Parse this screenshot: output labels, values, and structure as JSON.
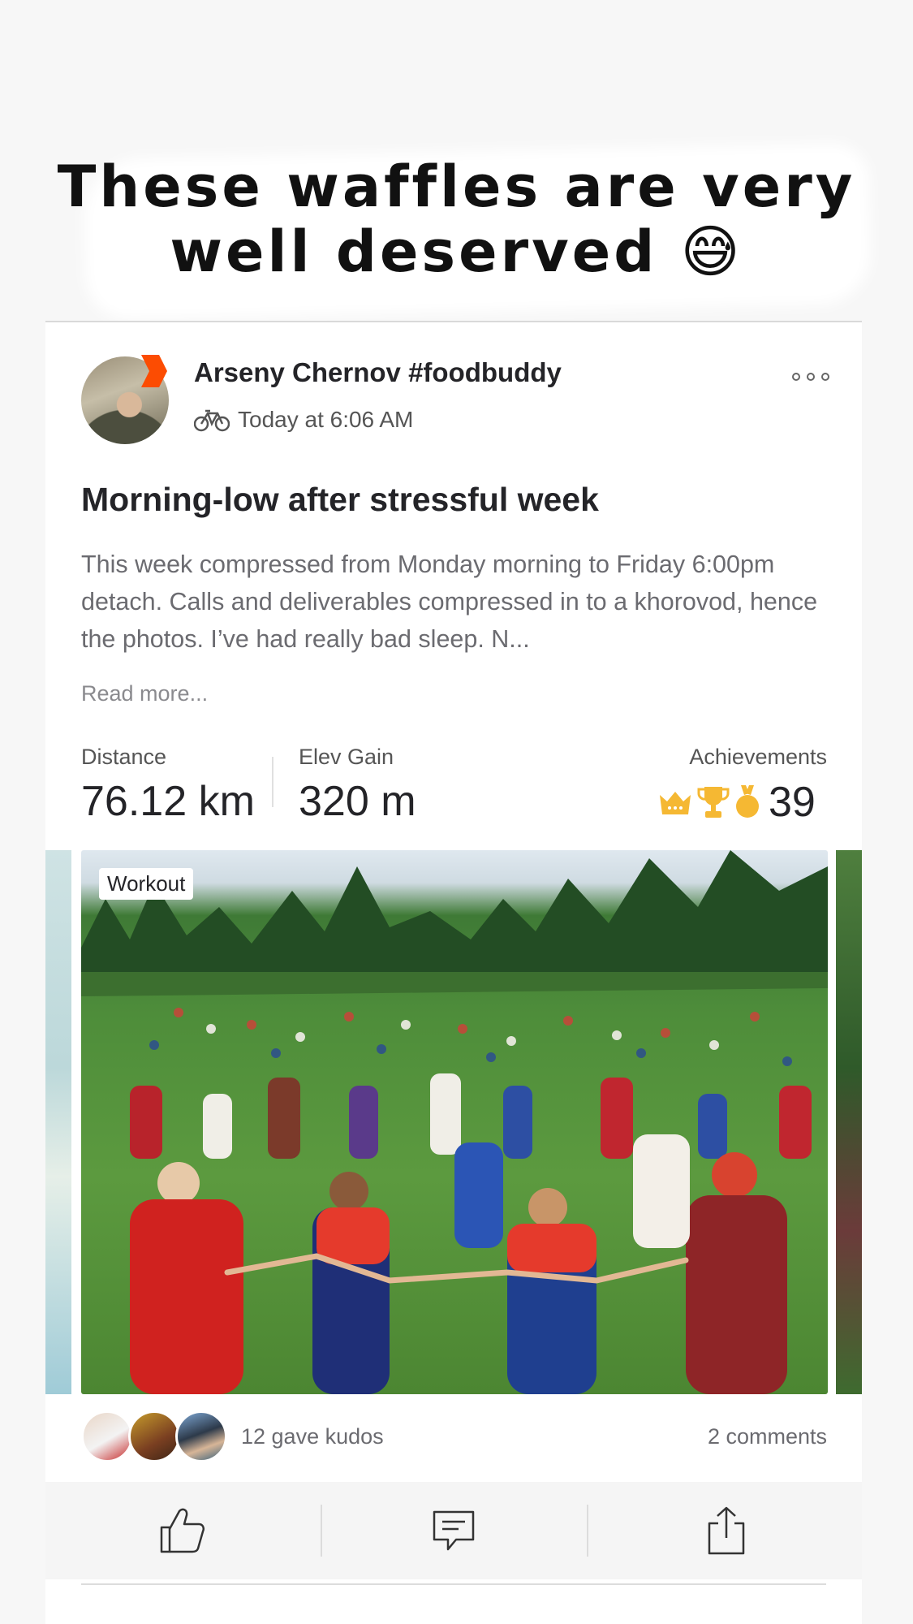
{
  "caption": "These waffles are very well deserved 😅",
  "post": {
    "author": "Arseny Chernov #foodbuddy",
    "timestamp": "Today at 6:06 AM",
    "activity_type_icon": "bicycle-icon",
    "title": "Morning-low after stressful week",
    "description": "This week compressed from Monday morning to Friday 6:00pm detach. Calls and deliverables compressed in to a khorovod, hence the photos. I’ve had really bad sleep. N...",
    "read_more": "Read more..."
  },
  "stats": {
    "distance_label": "Distance",
    "distance_value": "76.12 km",
    "elev_label": "Elev Gain",
    "elev_value": "320 m",
    "achievements_label": "Achievements",
    "achievements_value": "39",
    "achievement_icons": [
      "crown-icon",
      "trophy-icon",
      "medal-icon"
    ],
    "achievement_color": "#f5b833"
  },
  "media": {
    "tag": "Workout"
  },
  "social": {
    "kudos_text": "12 gave kudos",
    "comments_text": "2 comments"
  },
  "actions": [
    "kudos-icon",
    "comment-icon",
    "share-icon"
  ],
  "colors": {
    "brand": "#fc4c02",
    "text_primary": "#242428",
    "text_secondary": "#6b6b70"
  }
}
